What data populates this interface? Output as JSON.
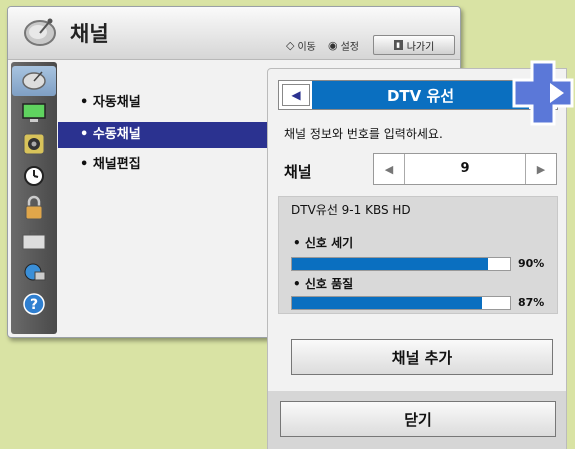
{
  "header": {
    "title": "채널",
    "hints": [
      {
        "icon": "navigate-icon",
        "symbol": "◇",
        "label": "이동"
      },
      {
        "icon": "select-icon",
        "symbol": "◉",
        "label": "설정"
      }
    ],
    "exit_label": "나가기"
  },
  "sidebar": {
    "items": [
      {
        "icon": "satellite-dish-icon",
        "selected": true
      },
      {
        "icon": "monitor-icon",
        "selected": false
      },
      {
        "icon": "speaker-icon",
        "selected": false
      },
      {
        "icon": "clock-icon",
        "selected": false
      },
      {
        "icon": "lock-icon",
        "selected": false
      },
      {
        "icon": "toolbox-icon",
        "selected": false
      },
      {
        "icon": "network-icon",
        "selected": false
      },
      {
        "icon": "help-icon",
        "selected": false
      }
    ]
  },
  "menu": {
    "items": [
      {
        "label": "• 자동채널",
        "selected": false
      },
      {
        "label": "• 수동채널",
        "selected": true
      },
      {
        "label": "• 채널편집",
        "selected": false
      }
    ]
  },
  "panel": {
    "source_title": "DTV 유선",
    "prompt": "채널 정보와 번호를 입력하세요.",
    "channel_label": "채널",
    "channel_value": "9",
    "info_title": "DTV유선 9-1 KBS HD",
    "signals": [
      {
        "label": "• 신호 세기",
        "value": 90,
        "text": "90%"
      },
      {
        "label": "• 신호 품질",
        "value": 87,
        "text": "87%"
      }
    ],
    "add_button": "채널 추가",
    "close_button": "닫기"
  },
  "colors": {
    "accent_blue": "#0a6fc0",
    "menu_selected": "#2b3290",
    "background": "#d9e3a4"
  }
}
